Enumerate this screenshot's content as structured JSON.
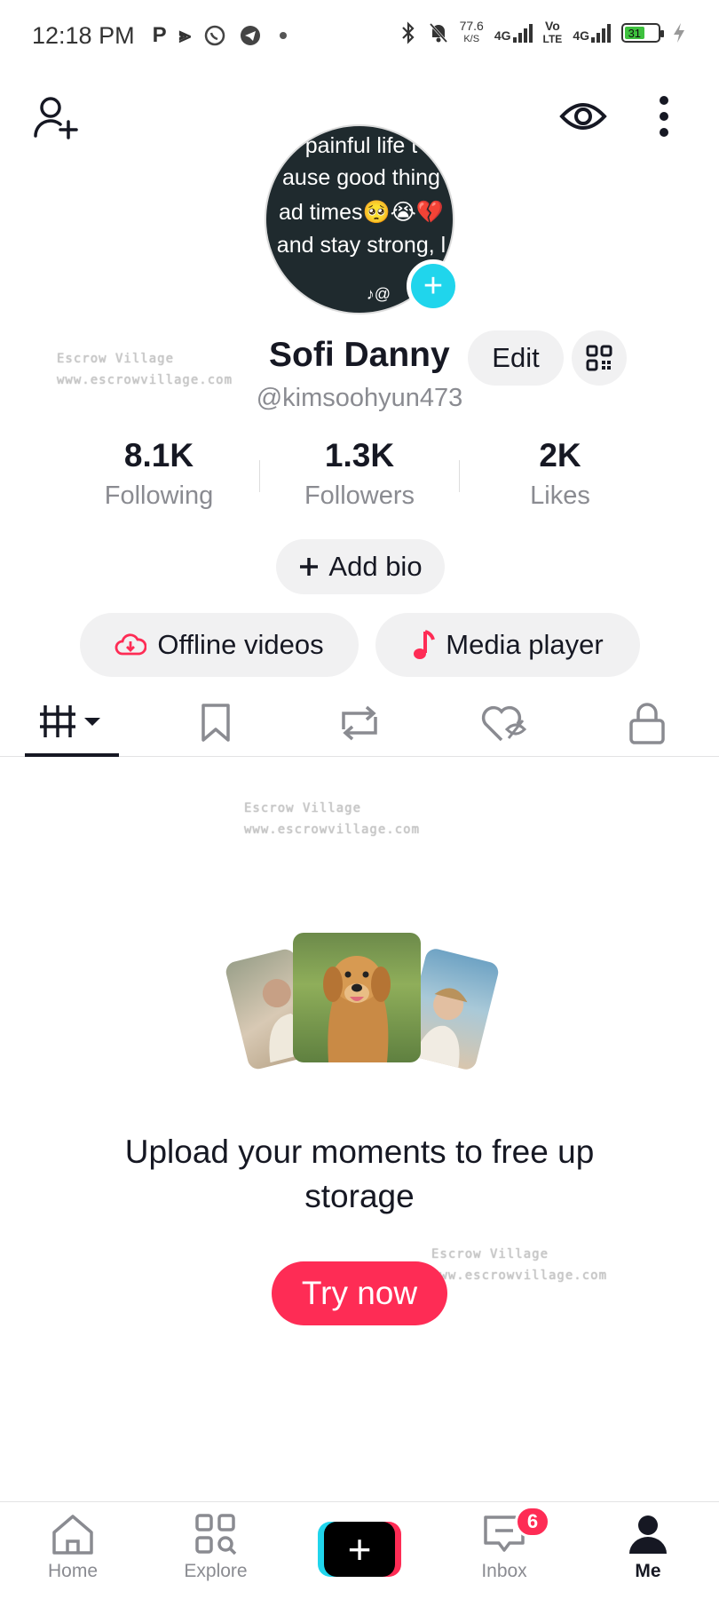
{
  "status_bar": {
    "time": "12:18 PM",
    "speed_value": "77.6",
    "speed_unit": "K/S",
    "net1": "4G",
    "net2_top": "Vo",
    "net2_bottom": "LTE",
    "net3": "4G",
    "battery": "31",
    "app_glyphs": [
      "P",
      "⫸"
    ]
  },
  "header": {
    "add_friend_icon": "person-plus-icon",
    "views_icon": "eye-icon",
    "menu_icon": "more-vertical-icon"
  },
  "profile": {
    "avatar_lines": [
      "painful life t",
      "ause good thing",
      "ad times🥺😭💔",
      "and stay strong, l"
    ],
    "display_name": "Sofi Danny",
    "edit_label": "Edit",
    "handle": "@kimsoohyun473",
    "add_bio_label": "Add bio"
  },
  "stats": [
    {
      "value": "8.1K",
      "label": "Following"
    },
    {
      "value": "1.3K",
      "label": "Followers"
    },
    {
      "value": "2K",
      "label": "Likes"
    }
  ],
  "shortcuts": {
    "offline_label": "Offline videos",
    "media_label": "Media player"
  },
  "tabs": [
    "videos-grid-icon",
    "bookmark-icon",
    "repost-icon",
    "liked-hidden-icon",
    "lock-icon"
  ],
  "watermark": {
    "line1": "Escrow Village",
    "line2": "www.escrowvillage.com"
  },
  "promo": {
    "title": "Upload your moments to free up storage",
    "button_label": "Try now"
  },
  "bottom_nav": {
    "home": "Home",
    "explore": "Explore",
    "inbox": "Inbox",
    "inbox_badge": "6",
    "me": "Me"
  },
  "colors": {
    "accent": "#fe2c55",
    "cyan": "#20d5ec",
    "text": "#161823",
    "muted": "#8a8b91",
    "pill_bg": "#f1f1f2"
  }
}
